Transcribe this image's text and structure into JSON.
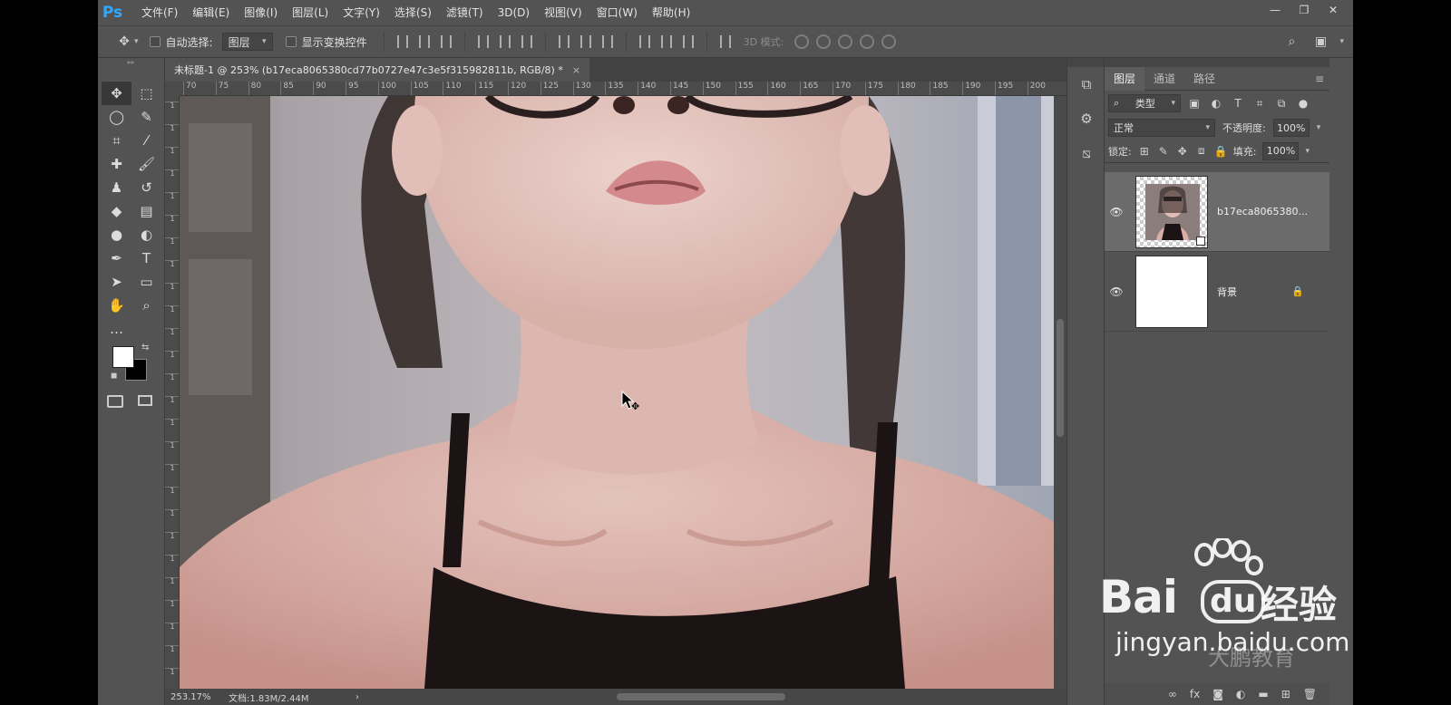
{
  "app": {
    "logo": "Ps",
    "menus": [
      "文件(F)",
      "编辑(E)",
      "图像(I)",
      "图层(L)",
      "文字(Y)",
      "选择(S)",
      "滤镜(T)",
      "3D(D)",
      "视图(V)",
      "窗口(W)",
      "帮助(H)"
    ],
    "window_controls": {
      "minimize": "—",
      "restore": "❐",
      "close": "✕"
    }
  },
  "options_bar": {
    "auto_select_label": "自动选择:",
    "auto_select_value": "图层",
    "show_transform_label": "显示变换控件",
    "mode_3d_label": "3D 模式:"
  },
  "document": {
    "tab_title": "未标题-1 @ 253% (b17eca8065380cd77b0727e47c3e5f315982811b, RGB/8) *",
    "close": "×",
    "ruler_h_labels": [
      "70",
      "75",
      "80",
      "85",
      "90",
      "95",
      "100",
      "105",
      "110",
      "115",
      "120",
      "125",
      "130",
      "135",
      "140",
      "145",
      "150",
      "155",
      "160",
      "165",
      "170",
      "175",
      "180",
      "185",
      "190",
      "195",
      "200"
    ],
    "ruler_v_labels": [
      "1",
      "1",
      "1",
      "1",
      "1",
      "1",
      "1",
      "1",
      "1",
      "1",
      "1",
      "1",
      "1",
      "1",
      "1",
      "1",
      "1",
      "1",
      "1",
      "1",
      "1",
      "1",
      "1",
      "1",
      "1",
      "1"
    ],
    "zoom": "253.17%",
    "doc_size": "文档:1.83M/2.44M",
    "status_arrow": "›"
  },
  "layers_panel": {
    "tabs": [
      "图层",
      "通道",
      "路径"
    ],
    "filter_label": "类型",
    "blend_mode": "正常",
    "opacity_label": "不透明度:",
    "opacity": "100%",
    "lock_label": "锁定:",
    "fill_label": "填充:",
    "fill": "100%",
    "layers": [
      {
        "name": "b17eca8065380...",
        "visible": true,
        "selected": true
      },
      {
        "name": "背景",
        "visible": true,
        "selected": false,
        "locked": true
      }
    ],
    "footer_icons": [
      "link-icon",
      "fx-icon",
      "mask-icon",
      "adjustment-icon",
      "group-icon",
      "new-layer-icon",
      "trash-icon"
    ]
  },
  "watermark": {
    "brand": "Bai",
    "brand_du": "du",
    "cn": "经验",
    "url": "jingyan.baidu.com",
    "secondary": "大鹏教育"
  },
  "colors": {
    "ui_bg": "#535353",
    "accent": "#31a8ff",
    "foreground": "#ffffff",
    "background": "#000000"
  }
}
